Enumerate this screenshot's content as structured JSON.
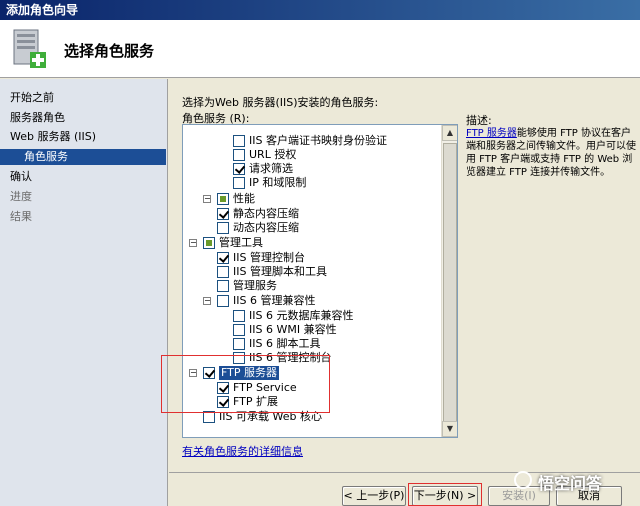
{
  "window": {
    "title": "添加角色向导"
  },
  "header": {
    "title": "选择角色服务"
  },
  "nav": {
    "items": [
      {
        "label": "开始之前",
        "state": "normal"
      },
      {
        "label": "服务器角色",
        "state": "normal"
      },
      {
        "label": "Web 服务器 (IIS)",
        "state": "normal"
      },
      {
        "label": "角色服务",
        "state": "selected"
      },
      {
        "label": "确认",
        "state": "normal"
      },
      {
        "label": "进度",
        "state": "dim"
      },
      {
        "label": "结果",
        "state": "dim"
      }
    ]
  },
  "main": {
    "instruction": "选择为Web 服务器(IIS)安装的角色服务:",
    "list_label": "角色服务 (R):",
    "tree": [
      {
        "label": "IIS 客户端证书映射身份验证",
        "checked": false
      },
      {
        "label": "URL 授权",
        "checked": false
      },
      {
        "label": "请求筛选",
        "checked": true
      },
      {
        "label": "IP 和域限制",
        "checked": false
      },
      {
        "label": "性能",
        "checked": "partial",
        "expander": "minus"
      },
      {
        "label": "静态内容压缩",
        "checked": true
      },
      {
        "label": "动态内容压缩",
        "checked": false
      },
      {
        "label": "管理工具",
        "checked": "partial",
        "expander": "minus"
      },
      {
        "label": "IIS 管理控制台",
        "checked": true
      },
      {
        "label": "IIS 管理脚本和工具",
        "checked": false
      },
      {
        "label": "管理服务",
        "checked": false
      },
      {
        "label": "IIS 6 管理兼容性",
        "checked": false,
        "expander": "minus"
      },
      {
        "label": "IIS 6 元数据库兼容性",
        "checked": false
      },
      {
        "label": "IIS 6 WMI 兼容性",
        "checked": false
      },
      {
        "label": "IIS 6 脚本工具",
        "checked": false
      },
      {
        "label": "IIS 6 管理控制台",
        "checked": false
      },
      {
        "label": "FTP 服务器",
        "checked": true,
        "expander": "minus",
        "selected": true
      },
      {
        "label": "FTP Service",
        "checked": true
      },
      {
        "label": "FTP 扩展",
        "checked": true
      },
      {
        "label": "IIS 可承载 Web 核心",
        "checked": false
      }
    ],
    "more_link": "有关角色服务的详细信息"
  },
  "description": {
    "title": "描述:",
    "link": "FTP 服务器",
    "body": "能够使用 FTP 协议在客户端和服务器之间传输文件。用户可以使用 FTP 客户端或支持 FTP 的 Web 浏览器建立 FTP 连接并传输文件。"
  },
  "buttons": {
    "back": "< 上一步(P)",
    "next": "下一步(N) >",
    "install": "安装(I)",
    "cancel": "取消"
  },
  "watermark": {
    "text": "悟空问答"
  },
  "colors": {
    "selection": "#1c4e96",
    "highlight_box": "#e03030",
    "link": "#0000c0"
  }
}
